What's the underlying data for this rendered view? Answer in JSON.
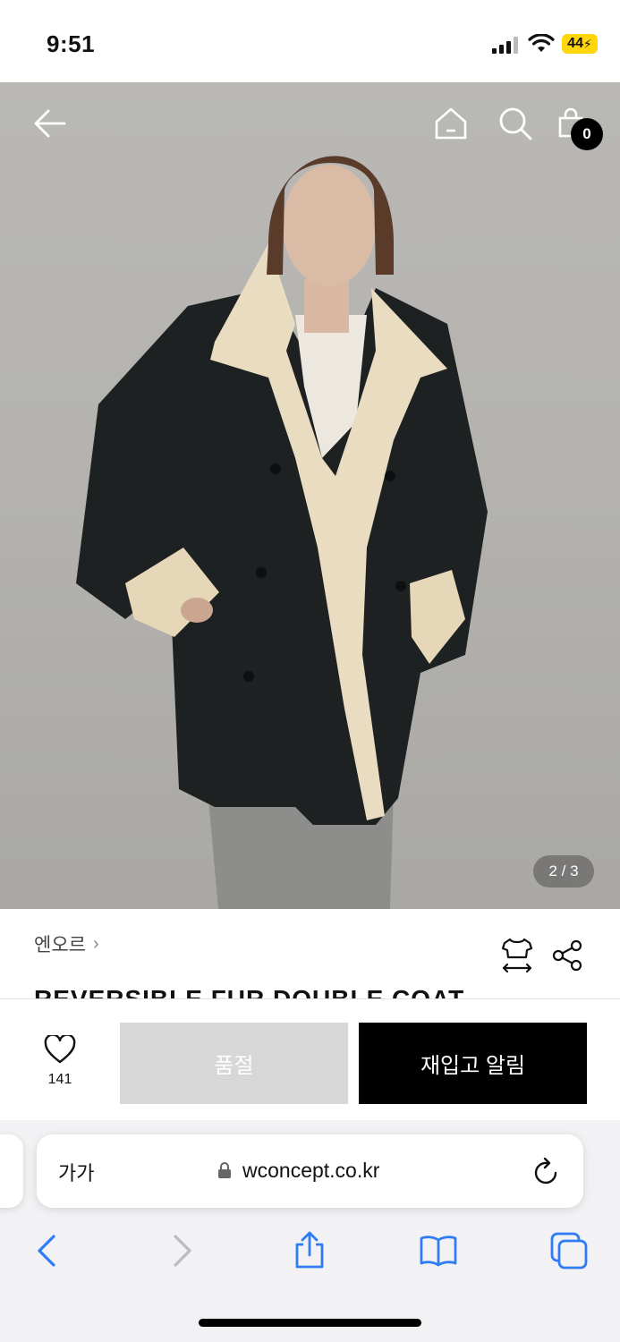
{
  "status_bar": {
    "time": "9:51",
    "battery": "44"
  },
  "header": {
    "cart_count": "0"
  },
  "gallery": {
    "page_indicator": "2 / 3"
  },
  "product": {
    "brand": "엔오르",
    "brand_chevron": "›",
    "title": "REVERSIBLE FUR DOUBLE COAT"
  },
  "purchase_bar": {
    "wish_count": "141",
    "soldout_label": "품절",
    "restock_label": "재입고 알림"
  },
  "browser": {
    "reader_label": "가가",
    "url": "wconcept.co.kr"
  },
  "colors": {
    "accent": "#000000",
    "soldout_bg": "#d7d7d7",
    "safari_blue": "#2f7cf6",
    "battery": "#ffd60a"
  }
}
